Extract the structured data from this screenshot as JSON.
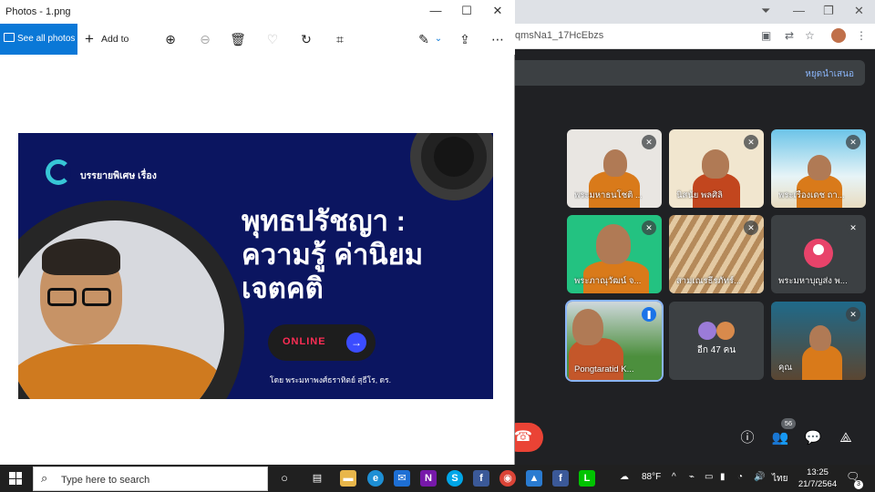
{
  "chrome": {
    "url_fragment": "qmsNa1_17HcEbzs"
  },
  "meet": {
    "stop_presenting": "หยุดนำเสนอ",
    "tiles": [
      {
        "name": "พระมหาธนโชติ ..."
      },
      {
        "name": "นิสนัย พลศิลิ"
      },
      {
        "name": "พระเรืองเดช ถา..."
      },
      {
        "name": "พระภาณุวัฒน์ จ..."
      },
      {
        "name": "สามเณรธีรภัทร์..."
      },
      {
        "name": "พระมหาบุญส่ง พ..."
      },
      {
        "name": "Pongtaratid K..."
      },
      {
        "name": "อีก 47 คน"
      },
      {
        "name": "คุณ"
      }
    ],
    "people_count": "56"
  },
  "photos": {
    "title": "Photos - 1.png",
    "see_all": "See all photos",
    "add_to": "Add to"
  },
  "slide": {
    "special": "บรรยายพิเศษ เรื่อง",
    "line1": "พุทธปรัชญา :",
    "line2": "ความรู้ ค่านิยม",
    "line3": "เจตคติ",
    "online": "ONLINE",
    "byline": "โดย พระมหาพงศ์ธราทิตย์ สุธีโร, ดร."
  },
  "taskbar": {
    "search_placeholder": "Type here to search",
    "temperature": "88°F",
    "lang": "ไทย",
    "time": "13:25",
    "date": "21/7/2564",
    "notif_count": "3"
  }
}
